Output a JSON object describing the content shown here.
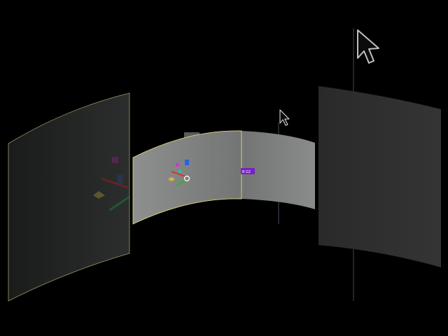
{
  "scene": {
    "background_color": "#000000",
    "outline_color": "#c8c878",
    "left_panel": {
      "name": "left-curved-panel",
      "selected": true
    },
    "center_panel": {
      "name": "center-curved-panel",
      "selected": true
    },
    "right_panel": {
      "name": "right-curved-panel",
      "selected": false
    },
    "gizmo": {
      "axis_x_color": "#e03030",
      "axis_y_color": "#30b030",
      "axis_z_color": "#3060e0",
      "handle_color": "#ffffff"
    },
    "tag_label": "B G2",
    "tag_color": "#7a1fc8",
    "cursors": [
      {
        "name": "large-cursor-icon"
      },
      {
        "name": "small-cursor-icon"
      }
    ]
  }
}
